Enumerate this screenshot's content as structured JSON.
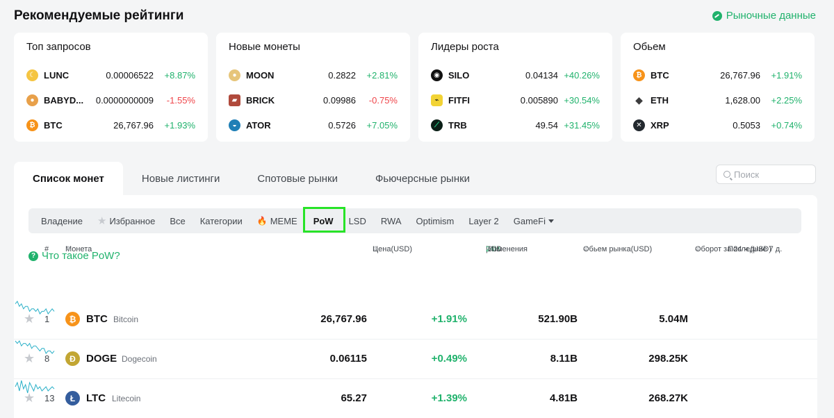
{
  "header": {
    "title": "Рекомендуемые рейтинги",
    "market_link": "Рыночные данные"
  },
  "cards": [
    {
      "title": "Топ запросов",
      "rows": [
        {
          "symbol": "LUNC",
          "price": "0.00006522",
          "change": "+8.87%",
          "dir": "up",
          "icon_color": "#f5c542",
          "icon": "moon-icon"
        },
        {
          "symbol": "BABYD...",
          "price": "0.0000000009",
          "change": "-1.55%",
          "dir": "down",
          "icon_color": "#e8a04a",
          "icon": "babydoge-icon"
        },
        {
          "symbol": "BTC",
          "price": "26,767.96",
          "change": "+1.93%",
          "dir": "up",
          "icon_color": "#f7931a",
          "icon": "bitcoin-icon"
        }
      ]
    },
    {
      "title": "Новые монеты",
      "rows": [
        {
          "symbol": "MOON",
          "price": "0.2822",
          "change": "+2.81%",
          "dir": "up",
          "icon_color": "#e6c57a",
          "icon": "moon-coin-icon"
        },
        {
          "symbol": "BRICK",
          "price": "0.09986",
          "change": "-0.75%",
          "dir": "down",
          "icon_color": "#b04a3c",
          "icon": "brick-icon"
        },
        {
          "symbol": "ATOR",
          "price": "0.5726",
          "change": "+7.05%",
          "dir": "up",
          "icon_color": "#1f7fb6",
          "icon": "ator-icon"
        }
      ]
    },
    {
      "title": "Лидеры роста",
      "rows": [
        {
          "symbol": "SILO",
          "price": "0.04134",
          "change": "+40.26%",
          "dir": "up",
          "icon_color": "#111111",
          "icon": "silo-icon"
        },
        {
          "symbol": "FITFI",
          "price": "0.005890",
          "change": "+30.54%",
          "dir": "up",
          "icon_color": "#f2d335",
          "icon": "fitfi-icon"
        },
        {
          "symbol": "TRB",
          "price": "49.54",
          "change": "+31.45%",
          "dir": "up",
          "icon_color": "#0b1f17",
          "icon": "trb-icon"
        }
      ]
    },
    {
      "title": "Обьем",
      "rows": [
        {
          "symbol": "BTC",
          "price": "26,767.96",
          "change": "+1.91%",
          "dir": "up",
          "icon_color": "#f7931a",
          "icon": "bitcoin-icon"
        },
        {
          "symbol": "ETH",
          "price": "1,628.00",
          "change": "+2.25%",
          "dir": "up",
          "icon_color": "#ffffff",
          "icon": "ethereum-icon"
        },
        {
          "symbol": "XRP",
          "price": "0.5053",
          "change": "+0.74%",
          "dir": "up",
          "icon_color": "#23292f",
          "icon": "xrp-icon"
        }
      ]
    }
  ],
  "tabs": [
    "Список монет",
    "Новые листинги",
    "Спотовые рынки",
    "Фьючерсные рынки"
  ],
  "search": {
    "placeholder": "Поиск"
  },
  "filters": {
    "holding": "Владение",
    "favorites": "Избранное",
    "all": "Все",
    "categories": "Категории",
    "meme": "MEME",
    "pow": "PoW",
    "lsd": "LSD",
    "rwa": "RWA",
    "optimism": "Optimism",
    "layer2": "Layer 2",
    "gamefi": "GameFi"
  },
  "pow_link": "Что такое PoW?",
  "table": {
    "headers": {
      "num": "#",
      "coin": "Монета",
      "price": "Цена(USD)",
      "h24": "24H",
      "d30": "30D",
      "change": "Изменения",
      "cap": "Обьем рынка(USD)",
      "vol": "Оборот за 24 ч.(USD)",
      "last7": "Последние 7 д."
    },
    "rows": [
      {
        "rank": "1",
        "symbol": "BTC",
        "name": "Bitcoin",
        "price": "26,767.96",
        "change": "+1.91%",
        "cap": "521.90B",
        "vol": "5.04M",
        "icon_color": "#f7931a",
        "spark": [
          6,
          5,
          7,
          6,
          8,
          7,
          7,
          9,
          8,
          8,
          9,
          8,
          10,
          9,
          9,
          8,
          10,
          9,
          8,
          9
        ]
      },
      {
        "rank": "8",
        "symbol": "DOGE",
        "name": "Dogecoin",
        "price": "0.06115",
        "change": "+0.49%",
        "cap": "8.11B",
        "vol": "298.25K",
        "icon_color": "#c2a633",
        "spark": [
          5,
          6,
          5,
          7,
          6,
          6,
          7,
          6,
          8,
          7,
          7,
          8,
          9,
          8,
          8,
          10,
          9,
          9,
          10,
          9
        ]
      },
      {
        "rank": "13",
        "symbol": "LTC",
        "name": "Litecoin",
        "price": "65.27",
        "change": "+1.39%",
        "cap": "4.81B",
        "vol": "268.27K",
        "icon_color": "#345d9d",
        "spark": [
          7,
          5,
          9,
          4,
          8,
          6,
          10,
          5,
          7,
          9,
          6,
          8,
          7,
          9,
          8,
          7,
          9,
          8,
          7,
          8
        ]
      }
    ]
  }
}
